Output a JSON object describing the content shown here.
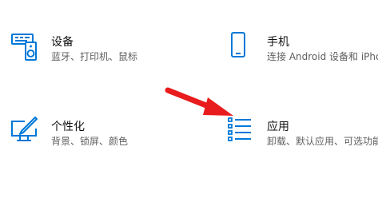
{
  "settings": {
    "devices": {
      "title": "设备",
      "desc": "蓝牙、打印机、鼠标",
      "icon": "keyboard-speaker-icon"
    },
    "phone": {
      "title": "手机",
      "desc": "连接 Android 设备和 iPho",
      "icon": "phone-icon"
    },
    "personalization": {
      "title": "个性化",
      "desc": "背景、锁屏、颜色",
      "icon": "paintbrush-monitor-icon"
    },
    "apps": {
      "title": "应用",
      "desc": "卸载、默认应用、可选功能",
      "icon": "apps-list-icon"
    }
  },
  "annotation": {
    "arrow_color": "#e81c1c",
    "accent_color": "#0078d7"
  }
}
